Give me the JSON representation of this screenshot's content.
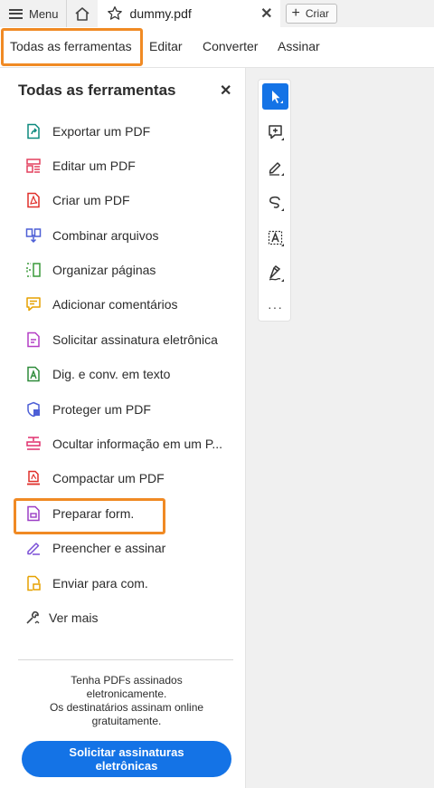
{
  "tabbar": {
    "menu_label": "Menu",
    "doc_title": "dummy.pdf",
    "close_glyph": "✕",
    "create_label": "Criar"
  },
  "menubar": {
    "items": [
      "Todas as ferramentas",
      "Editar",
      "Converter",
      "Assinar"
    ]
  },
  "panel": {
    "title": "Todas as ferramentas",
    "close_glyph": "✕",
    "tools": [
      {
        "label": "Exportar um PDF",
        "icon": "export-pdf-icon",
        "color": "#0d8a7e"
      },
      {
        "label": "Editar um PDF",
        "icon": "edit-pdf-icon",
        "color": "#e3405f"
      },
      {
        "label": "Criar um PDF",
        "icon": "create-pdf-icon",
        "color": "#e0302b"
      },
      {
        "label": "Combinar arquivos",
        "icon": "combine-files-icon",
        "color": "#4d5fd6"
      },
      {
        "label": "Organizar páginas",
        "icon": "organize-pages-icon",
        "color": "#3a9a3a"
      },
      {
        "label": "Adicionar comentários",
        "icon": "add-comment-icon",
        "color": "#e6a100"
      },
      {
        "label": "Solicitar assinatura eletrônica",
        "icon": "request-signature-icon",
        "color": "#b43ec5"
      },
      {
        "label": "Dig. e conv. em texto",
        "icon": "scan-ocr-icon",
        "color": "#2e8b3a"
      },
      {
        "label": "Proteger um PDF",
        "icon": "protect-pdf-icon",
        "color": "#4d5fd6"
      },
      {
        "label": "Ocultar informação em um P...",
        "icon": "redact-icon",
        "color": "#e0306e"
      },
      {
        "label": "Compactar um PDF",
        "icon": "compress-pdf-icon",
        "color": "#e0302b"
      },
      {
        "label": "Preparar form.",
        "icon": "prepare-form-icon",
        "color": "#9b3ec5"
      },
      {
        "label": "Preencher e assinar",
        "icon": "fill-sign-icon",
        "color": "#7a4fd6"
      },
      {
        "label": "Enviar para com.",
        "icon": "send-for-comments-icon",
        "color": "#e6a100"
      },
      {
        "label": "Ver mais",
        "icon": "wrench-icon",
        "color": "#444444"
      }
    ],
    "promo_lines": [
      "Tenha PDFs assinados",
      "eletronicamente.",
      "Os destinatários assinam online",
      "gratuitamente."
    ],
    "cta_lines": [
      "Solicitar assinaturas",
      "eletrônicas"
    ]
  },
  "toolbar": {
    "tools": [
      "select-cursor-icon",
      "add-comment-icon",
      "highlight-pen-icon",
      "freehand-draw-icon",
      "text-select-icon",
      "sign-icon",
      "more-options-icon"
    ],
    "more_glyph": "···"
  },
  "colors": {
    "accent_blue": "#1473e6",
    "highlight_orange": "#f08a24"
  }
}
